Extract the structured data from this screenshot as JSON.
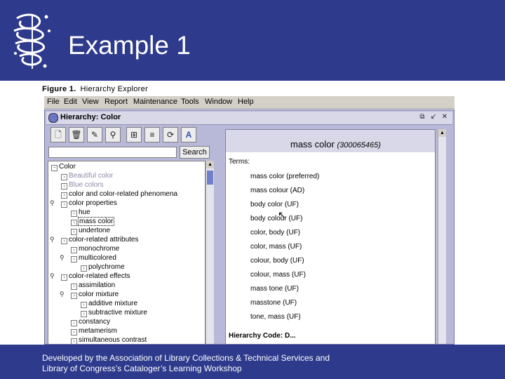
{
  "slide": {
    "title": "Example 1",
    "footer_line1": "Developed by the Association of Library Collections & Technical Services and",
    "footer_line2": "Library of Congress’s Cataloger’s Learning Workshop"
  },
  "figure": {
    "label": "Figure 1.",
    "title": "Hierarchy Explorer"
  },
  "menu": [
    "File",
    "Edit",
    "View",
    "Report",
    "Maintenance",
    "Tools",
    "Window",
    "Help"
  ],
  "window": {
    "title": "Hierarchy: Color"
  },
  "search": {
    "button": "Search",
    "value": ""
  },
  "tree": [
    {
      "label": "Color",
      "muted": false
    },
    {
      "label": "Beautiful color",
      "muted": true
    },
    {
      "label": "Blue colors",
      "muted": true
    },
    {
      "label": "color and color-related phenomena",
      "muted": false
    },
    {
      "label": "color properties",
      "muted": false
    },
    {
      "label": "hue",
      "muted": false
    },
    {
      "label": "mass color",
      "muted": false
    },
    {
      "label": "undertone",
      "muted": false
    },
    {
      "label": "color-related attributes",
      "muted": false
    },
    {
      "label": "monochrome",
      "muted": false
    },
    {
      "label": "multicolored",
      "muted": false
    },
    {
      "label": "polychrome",
      "muted": false
    },
    {
      "label": "color-related effects",
      "muted": false
    },
    {
      "label": "assimilation",
      "muted": false
    },
    {
      "label": "color mixture",
      "muted": false
    },
    {
      "label": "additive mixture",
      "muted": false
    },
    {
      "label": "subtractive mixture",
      "muted": false
    },
    {
      "label": "constancy",
      "muted": false
    },
    {
      "label": "metamerism",
      "muted": false
    },
    {
      "label": "simultaneous contrast",
      "muted": false
    }
  ],
  "record": {
    "term": "mass color",
    "code": "(300065465)",
    "terms_label": "Terms:",
    "terms": [
      "mass color (preferred)",
      "mass colour (AD)",
      "body color (UF)",
      "body colour (UF)",
      "color, body (UF)",
      "color, mass (UF)",
      "colour, body (UF)",
      "colour, mass (UF)",
      "mass tone (UF)",
      "masstone (UF)",
      "tone, mass (UF)"
    ],
    "hierarchy_label": "Hierarchy Code: D..."
  },
  "icons": {
    "toolbar": [
      "new-document-icon",
      "delete-icon",
      "edit-icon",
      "find-icon",
      "tree-expand-icon",
      "list-icon",
      "refresh-icon",
      "font-icon"
    ]
  },
  "colors": {
    "banner": "#2e3a8c",
    "panel": "#b8b8d8",
    "scroll_thumb": "#6f7fc8"
  }
}
